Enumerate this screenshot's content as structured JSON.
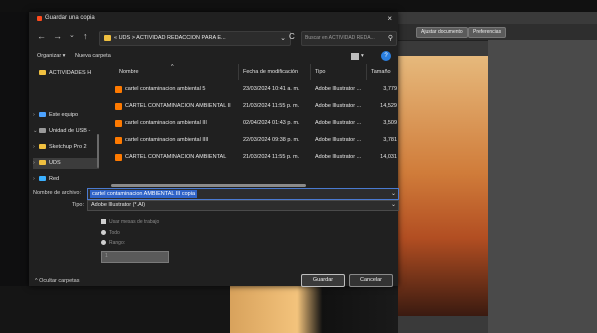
{
  "dialog": {
    "title": "Guardar una copia",
    "close": "×"
  },
  "nav": {
    "back": "←",
    "forward": "→",
    "dropdown": "⌄",
    "up": "↑",
    "path": "« UDS > ACTIVIDAD REDACCION PARA E...",
    "path_chevron": "⌄",
    "refresh": "C",
    "search_placeholder": "Buscar en ACTIVIDAD REDA...",
    "search_icon": "⚲"
  },
  "commands": {
    "organize": "Organizar ▾",
    "new_folder": "Nueva carpeta",
    "view_menu": "▾",
    "help": "?"
  },
  "sidebar": {
    "items": [
      {
        "label": "ACTIVIDADES H",
        "icon": "folder-icon"
      },
      {
        "label": "Este equipo",
        "icon": "pc-icon"
      },
      {
        "label": "Unidad de USB -",
        "icon": "usb-icon"
      },
      {
        "label": "Sketchup Pro 2",
        "icon": "folder-icon"
      },
      {
        "label": "UDS",
        "icon": "folder-icon"
      },
      {
        "label": "Red",
        "icon": "network-icon"
      }
    ]
  },
  "files": {
    "columns": [
      "Nombre",
      "Fecha de modificación",
      "Tipo",
      "Tamaño"
    ],
    "sort_indicator": "^",
    "rows": [
      {
        "name": "cartel contaminacion ambiental 5",
        "date": "23/03/2024 10:41 a. m.",
        "type": "Adobe Illustrator ...",
        "size": "3,779"
      },
      {
        "name": "CARTEL CONTAMINACION AMBIENTAL II",
        "date": "21/03/2024 11:55 p. m.",
        "type": "Adobe Illustrator ...",
        "size": "14,529"
      },
      {
        "name": "cartel contaminacion ambiental III",
        "date": "02/04/2024 01:43 p. m.",
        "type": "Adobe Illustrator ...",
        "size": "3,509"
      },
      {
        "name": "cartel contaminacion ambiental IIII",
        "date": "22/03/2024 09:38 p. m.",
        "type": "Adobe Illustrator ...",
        "size": "3,781"
      },
      {
        "name": "CARTEL CONTAMINACION AMBIENTAL",
        "date": "21/03/2024 11:55 p. m.",
        "type": "Adobe Illustrator ...",
        "size": "14,031"
      }
    ]
  },
  "save_form": {
    "filename_label": "Nombre de archivo:",
    "filename_value": "cartel contaminacion AMBIENTAL III copia",
    "type_label": "Tipo:",
    "type_value": "Adobe Illustrator (*.AI)",
    "use_artboards": "Usar mesas de trabajo",
    "all": "Todo",
    "range": "Rango:",
    "range_value": "1"
  },
  "footer": {
    "hide_folders": "^  Ocultar carpetas",
    "save_button": "Guardar",
    "cancel_button": "Cancelar"
  },
  "background": {
    "toolbar_button_1": "Ajustar documento",
    "toolbar_button_2": "Preferencias"
  }
}
